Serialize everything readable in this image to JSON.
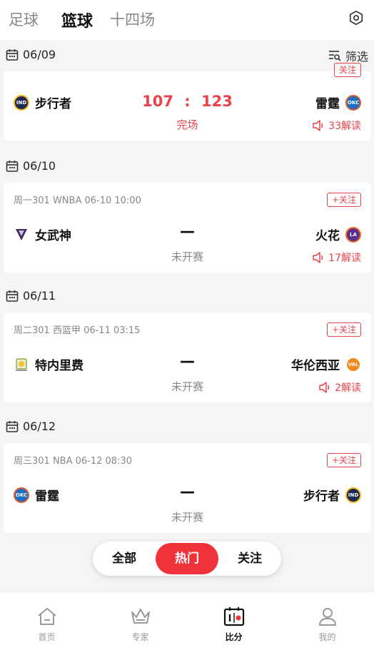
{
  "top_tabs": [
    "足球",
    "篮球",
    "十四场"
  ],
  "filter_label": "筛选",
  "dates": [
    "06/09",
    "06/10",
    "06/11",
    "06/12"
  ],
  "match1": {
    "follow": "关注",
    "home": "步行者",
    "home_logo": "IND",
    "away": "雷霆",
    "away_logo": "OKC",
    "score_home": "107",
    "score_sep": ":",
    "score_away": "123",
    "status": "完场",
    "reads": "33解读"
  },
  "match2": {
    "meta": "周一301 WNBA 06-10 10:00",
    "follow": "+关注",
    "home": "女武神",
    "away": "火花",
    "away_logo": "LA",
    "dash": "—",
    "status": "未开赛",
    "reads": "17解读"
  },
  "match3": {
    "meta": "周二301 西篮甲 06-11 03:15",
    "follow": "+关注",
    "home": "特内里费",
    "away": "华伦西亚",
    "away_logo": "VAL",
    "dash": "—",
    "status": "未开赛",
    "reads": "2解读"
  },
  "match4": {
    "meta": "周三301 NBA 06-12 08:30",
    "follow": "+关注",
    "home": "雷霆",
    "home_logo": "OKC",
    "away": "步行者",
    "away_logo": "IND",
    "dash": "—",
    "status": "未开赛"
  },
  "segment": [
    "全部",
    "热门",
    "关注"
  ],
  "bottom_nav": [
    "首页",
    "专家",
    "比分",
    "我的"
  ],
  "colors": {
    "accent": "#f0323a",
    "score_red": "#e8434a"
  }
}
